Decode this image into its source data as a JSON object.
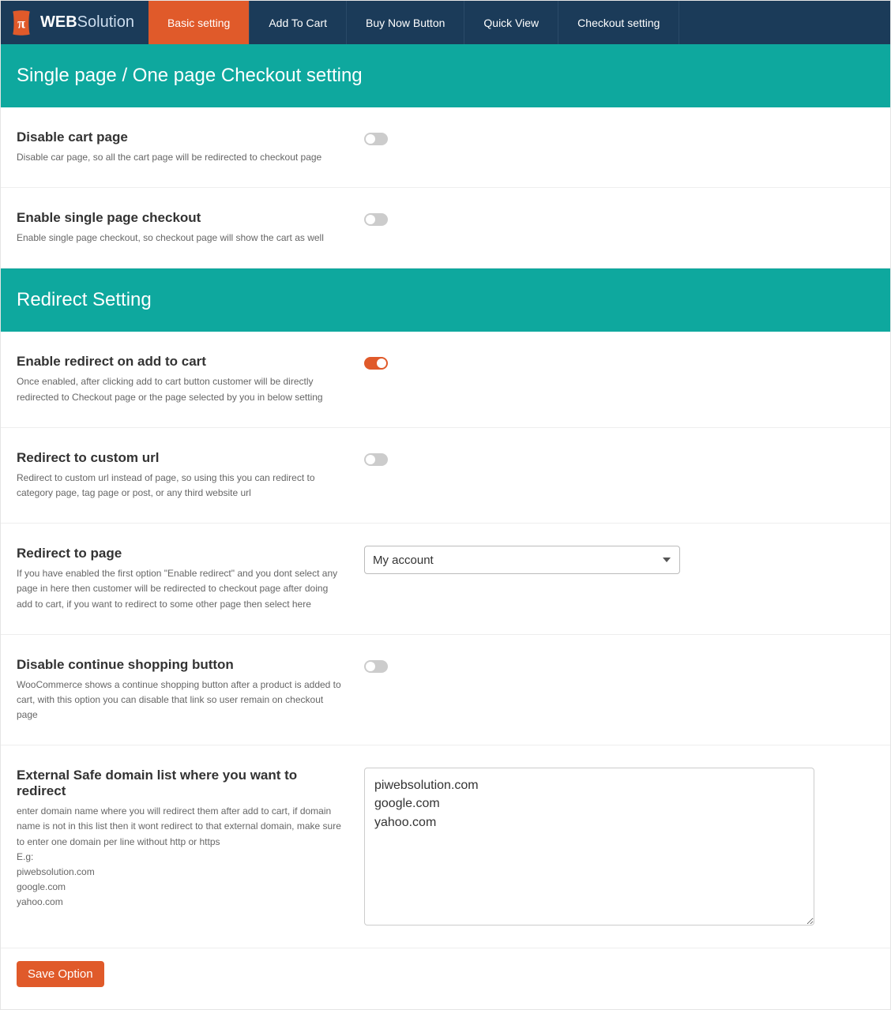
{
  "brand": {
    "bold": "WEB",
    "thin": "Solution"
  },
  "tabs": [
    "Basic setting",
    "Add To Cart",
    "Buy Now Button",
    "Quick View",
    "Checkout setting"
  ],
  "active_tab": 0,
  "sections": [
    {
      "title": "Single page / One page Checkout setting",
      "rows": [
        {
          "id": "disable-cart",
          "label": "Disable cart page",
          "desc": "Disable car page, so all the cart page will be redirected to checkout page",
          "control": "toggle",
          "value": false
        },
        {
          "id": "enable-single",
          "label": "Enable single page checkout",
          "desc": "Enable single page checkout, so checkout page will show the cart as well",
          "control": "toggle",
          "value": false
        }
      ]
    },
    {
      "title": "Redirect Setting",
      "rows": [
        {
          "id": "enable-redirect",
          "label": "Enable redirect on add to cart",
          "desc": "Once enabled, after clicking add to cart button customer will be directly redirected to Checkout page or the page selected by you in below setting",
          "control": "toggle",
          "value": true
        },
        {
          "id": "redirect-custom-url",
          "label": "Redirect to custom url",
          "desc": "Redirect to custom url instead of page, so using this you can redirect to category page, tag page or post, or any third website url",
          "control": "toggle",
          "value": false
        },
        {
          "id": "redirect-to-page",
          "label": "Redirect to page",
          "desc": "If you have enabled the first option \"Enable redirect\" and you dont select any page in here then customer will be redirected to checkout page after doing add to cart, if you want to redirect to some other page then select here",
          "control": "select",
          "value": "My account"
        },
        {
          "id": "disable-continue",
          "label": "Disable continue shopping button",
          "desc": "WooCommerce shows a continue shopping button after a product is added to cart, with this option you can disable that link so user remain on checkout page",
          "control": "toggle",
          "value": false
        },
        {
          "id": "safe-domains",
          "label": "External Safe domain list where you want to redirect",
          "desc": "enter domain name where you will redirect them after add to cart, if domain name is not in this list then it wont redirect to that external domain, make sure to enter one domain per line without http or https\nE.g:\npiwebsolution.com\ngoogle.com\nyahoo.com",
          "control": "textarea",
          "value": "piwebsolution.com\ngoogle.com\nyahoo.com"
        }
      ]
    }
  ],
  "save_label": "Save Option"
}
